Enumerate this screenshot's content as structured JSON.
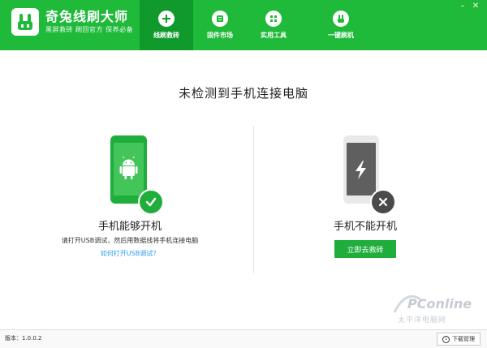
{
  "app": {
    "name": "奇兔线刷大师",
    "tagline": "黑屏救砖 刷回官方 保养必备"
  },
  "nav": [
    {
      "label": "线刷救砖",
      "icon": "plus-icon",
      "active": true
    },
    {
      "label": "固件市场",
      "icon": "rom-icon",
      "active": false
    },
    {
      "label": "实用工具",
      "icon": "grid-icon",
      "active": false
    },
    {
      "label": "一键刷机",
      "icon": "rabbit-icon",
      "active": false
    }
  ],
  "main": {
    "title": "未检测到手机连接电脑",
    "left": {
      "title": "手机能够开机",
      "hint": "请打开USB调试，然后用数据线将手机连接电脑",
      "link": "如何打开USB调试？"
    },
    "right": {
      "title": "手机不能开机",
      "button": "立即去救砖"
    }
  },
  "watermark": {
    "line1": "PConline",
    "line2": "太平洋电脑网"
  },
  "footer": {
    "version": "版本：1.0.0.2",
    "download_manager": "下载管理"
  },
  "colors": {
    "brand_green": "#1fba3a",
    "active_green": "#0f9a2b",
    "link_blue": "#2a9df0"
  }
}
